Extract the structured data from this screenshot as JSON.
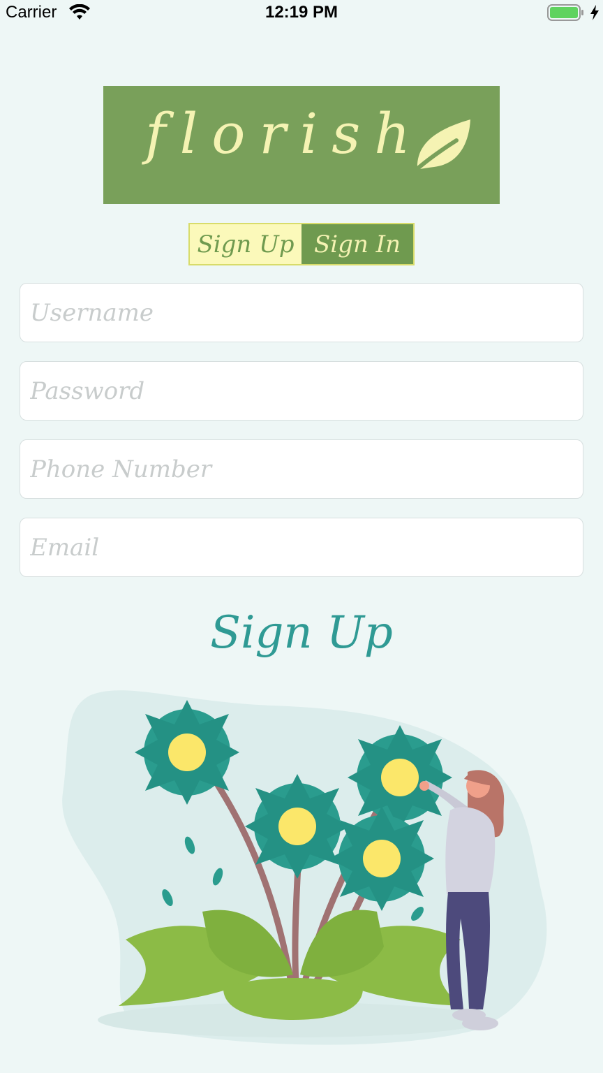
{
  "status_bar": {
    "carrier": "Carrier",
    "time": "12:19 PM",
    "icons": [
      "wifi-icon",
      "battery-icon",
      "charging-icon"
    ]
  },
  "logo": {
    "text": "florish",
    "icon": "leaf-icon",
    "background": "#79a05a",
    "text_color": "#f5f3b3"
  },
  "segmented_control": {
    "options": [
      {
        "label": "Sign Up",
        "selected": true
      },
      {
        "label": "Sign In",
        "selected": false
      }
    ],
    "colors": {
      "light": "#fbf9ba",
      "dark": "#6f9a4f"
    }
  },
  "form": {
    "username": {
      "placeholder": "Username",
      "value": ""
    },
    "password": {
      "placeholder": "Password",
      "value": ""
    },
    "phone": {
      "placeholder": "Phone Number",
      "value": ""
    },
    "email": {
      "placeholder": "Email",
      "value": ""
    }
  },
  "submit": {
    "label": "Sign Up",
    "color": "#2f9a94"
  },
  "illustration": {
    "icon": "woman-picking-flowers-illustration"
  }
}
